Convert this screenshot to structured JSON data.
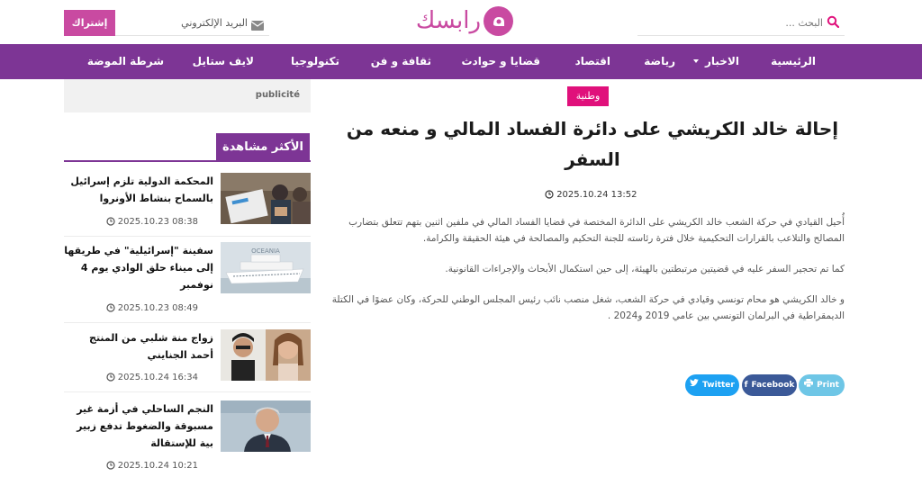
{
  "header": {
    "search_placeholder": "البحث ...",
    "logo_text": "رابسك",
    "email_placeholder": "البريد الإلكتروني",
    "subscribe_label": "إشتراك"
  },
  "nav": {
    "items": [
      "الرئيسية",
      "الاخبار",
      "رياضة",
      "اقتصاد",
      "قضايا و حوادث",
      "ثقافة و فن",
      "تكنولوجيا",
      "لايف ستايل",
      "شرطة الموضة"
    ]
  },
  "article": {
    "category": "وطنية",
    "title": "إحالة خالد الكريشي على دائرة الفساد المالي و منعه من السفر",
    "date": "13:52 2025.10.24",
    "paragraphs": [
      "أُحيل القيادي في حركة الشعب خالد الكريشي على الدائرة المختصة في قضايا الفساد المالي في ملفين اثنين بتهم تتعلق بتضارب المصالح والتلاعب بالقرارات التحكيمية خلال فترة رئاسته للجنة التحكيم والمصالحة في هيئة الحقيقة والكرامة.",
      "كما تم تحجير السفر عليه في قضيتين مرتبطتين بالهيئة، إلى حين استكمال الأبحاث والإجراءات القانونية.",
      "و خالد الكريشي هو محام تونسي وقيادي في حركة الشعب، شغل منصب نائب رئيس المجلس الوطني للحركة، وكان عضوًا في الكتلة الديمقراطية في البرلمان التونسي بين عامي 2019 و2024 ."
    ],
    "share": {
      "twitter": "Twitter",
      "facebook": "Facebook",
      "print": "Print"
    }
  },
  "sidebar": {
    "ad_label": "publicité",
    "most_viewed_title": "الأكثر مشاهدة",
    "items": [
      {
        "title": "المحكمة الدولية تلزم إسرائيل بالسماح بنشاط الأونروا",
        "date": "08:38 2025.10.23"
      },
      {
        "title": "سفينة \"إسرائيلية\" في طريقها إلى ميناء حلق الوادي يوم 4 نوفمبر",
        "date": "08:49 2025.10.23"
      },
      {
        "title": "زواج منة شلبي من المنتج أحمد الجنايني",
        "date": "16:34 2025.10.24"
      },
      {
        "title": "النجم الساحلي في أزمة غير مسبوقة والضغوط تدفع زبير بية للإستقالة",
        "date": "10:21 2025.10.24"
      }
    ],
    "ship_caption": "OCEANIA"
  },
  "colors": {
    "brand": "#c94aa1",
    "nav": "#7d3595",
    "category": "#e0107b",
    "twitter": "#1da1f2",
    "facebook": "#3b5998",
    "print": "#6ec6e6"
  }
}
